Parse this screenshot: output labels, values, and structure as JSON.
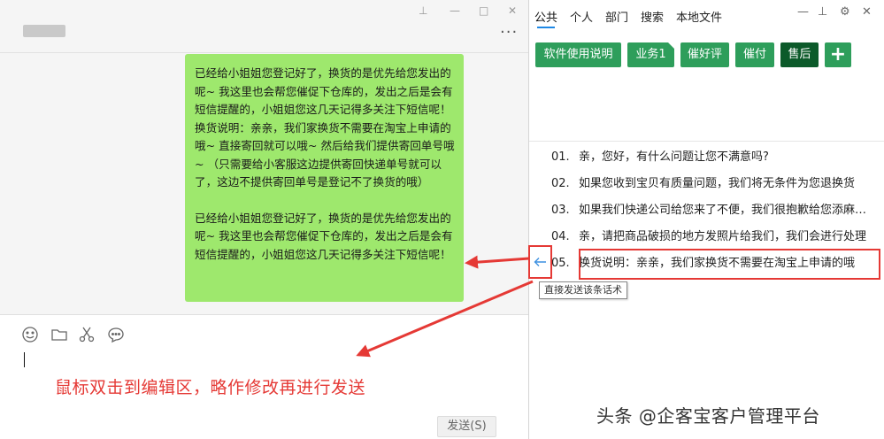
{
  "chat": {
    "message_paragraphs": [
      "已经给小姐姐您登记好了，换货的是优先给您发出的呢~ 我这里也会帮您催促下仓库的，发出之后是会有短信提醒的，小姐姐您这几天记得多关注下短信呢！换货说明：亲亲，我们家换货不需要在淘宝上申请的哦~ 直接寄回就可以哦~ 然后给我们提供寄回单号哦~ （只需要给小客服这边提供寄回快递单号就可以了，这边不提供寄回单号是登记不了换货的哦）",
      "已经给小姐姐您登记好了，换货的是优先给您发出的呢~ 我这里也会帮您催促下仓库的，发出之后是会有短信提醒的，小姐姐您这几天记得多关注下短信呢！"
    ],
    "more_glyph": "···",
    "window_controls": {
      "pin": "⊥",
      "minimize": "—",
      "maximize": "□",
      "close": "✕"
    },
    "toolbar_icons": [
      "emoji-icon",
      "folder-icon",
      "scissors-icon",
      "chat-bubble-icon"
    ],
    "edit_hint": "鼠标双击到编辑区，略作修改再进行发送",
    "send_label": "发送(S)"
  },
  "panel": {
    "tabs": [
      "公共",
      "个人",
      "部门",
      "搜索",
      "本地文件"
    ],
    "active_tab": 0,
    "controls": {
      "minimize": "—",
      "pin": "⊥",
      "settings": "⚙",
      "close": "✕"
    },
    "categories": [
      {
        "label": "软件使用说明",
        "dark": false
      },
      {
        "label": "业务1",
        "dark": false
      },
      {
        "label": "催好评",
        "dark": false
      },
      {
        "label": "催付",
        "dark": false
      },
      {
        "label": "售后",
        "dark": true
      }
    ],
    "add_label": "+",
    "replies": [
      {
        "num": "01.",
        "text": "亲，您好，有什么问题让您不满意吗?"
      },
      {
        "num": "02.",
        "text": "如果您收到宝贝有质量问题，我们将无条件为您退换货"
      },
      {
        "num": "03.",
        "text": "如果我们快递公司给您来了不便，我们很抱歉给您添麻烦了"
      },
      {
        "num": "04.",
        "text": "亲，请把商品破损的地方发照片给我们，我们会进行处理"
      },
      {
        "num": "05.",
        "text": "换货说明：亲亲，我们家换货不需要在淘宝上申请的哦"
      }
    ],
    "tooltip": "直接发送该条话术"
  },
  "watermark": "头条 @企客宝客户管理平台",
  "colors": {
    "bubble": "#9ee86d",
    "category": "#2e9e5b",
    "category_active": "#0c5a2a",
    "annotation": "#e53935",
    "tab_underline": "#1e88e5"
  }
}
